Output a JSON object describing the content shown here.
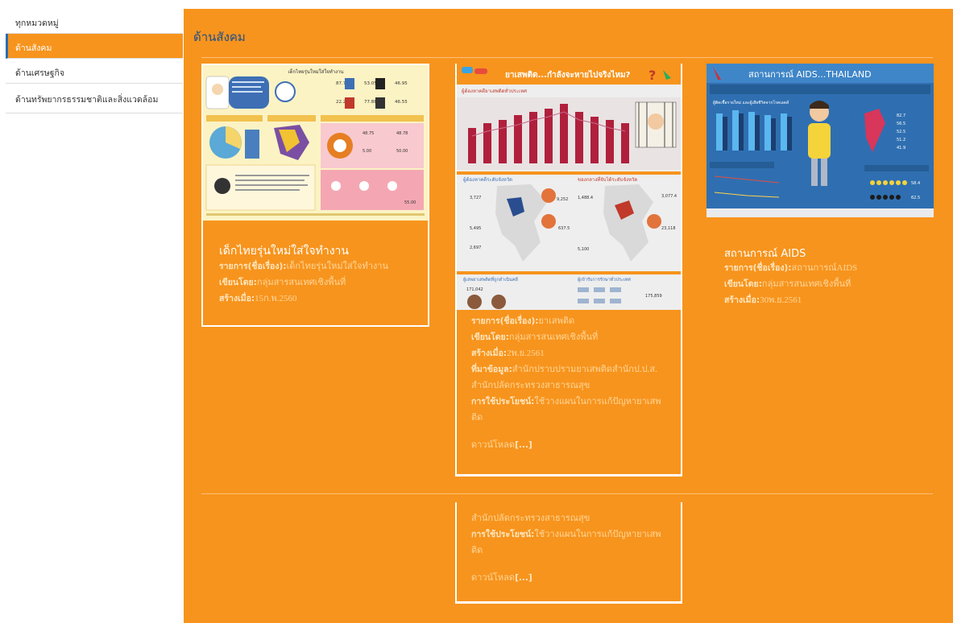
{
  "sidebar": {
    "items": [
      {
        "label": "ทุกหมวดหมู่"
      },
      {
        "label": "ด้านสังคม"
      },
      {
        "label": "ด้านเศรษฐกิจ"
      },
      {
        "label": "ด้านทรัพยากรธรรมชาติและสิ่งแวดล้อม"
      }
    ]
  },
  "main": {
    "section_title": "ด้านสังคม",
    "cards": [
      {
        "title": "เด็กไทยรุ่นใหม่ใส่ใจทำงาน",
        "topic_label": "รายการ(ชื่อเรื่อง):",
        "topic_value": "เด็กไทยรุ่นใหม่ใส่ใจทำงาน",
        "author_label": "เขียนโดย:",
        "author_value": "กลุ่มสารสนเทศเชิงพื้นที่",
        "created_label": "สร้างเมื่อ:",
        "created_value": "15ก.พ.2560",
        "infographic": {
          "heading": "เด็กไทยรุ่นใหม่ใส่ใจทำงาน",
          "stats": [
            "87.75",
            "53.05",
            "46.95",
            "22.25",
            "77.88",
            "46.55",
            "48.75",
            "48.78",
            "5.00",
            "50.00",
            "55.00"
          ]
        }
      },
      {
        "topic_label": "รายการ(ชื่อเรื่อง):",
        "topic_value": "ยาเสพติด",
        "author_label": "เขียนโดย:",
        "author_value": "กลุ่มสารสนเทศเชิงพื้นที่",
        "created_label": "สร้างเมื่อ:",
        "created_value": "2พ.ย.2561",
        "source_label": "ที่มาข้อมูล:",
        "source_value": "สำนักปราบปรามยาเสพติดสำนักป.ป.ส. สำนักปลัดกระทรวงสาธารณสุข",
        "usage_label": "การใช้ประโยชน์:",
        "usage_value": "ใช้วางแผนในการแก้ปัญหายาเสพติด",
        "download_label": "ดาวน์โหลด",
        "download_link": "[...]",
        "infographic": {
          "banner": "ยาเสพติด...กำลังจะหายไปจริงไหม?",
          "chart_title": "ผู้ต้องหาคดียาเสพติดทั่วประเทศ",
          "map_left_title": "ผู้ต้องหาคดีระดับจังหวัด",
          "map_right_title": "ของกลางที่จับได้ระดับจังหวัด",
          "bottom_left_title": "ผู้เสพยาเสพติดที่ถูกดำเนินคดี",
          "bottom_right_title": "ผู้เข้ารับการรักษาทั่วประเทศ",
          "figures": [
            "3,727",
            "9,252",
            "5,495",
            "2,697",
            "637.5",
            "3,077.4",
            "1,488.4",
            "23,118",
            "5,100",
            "171,042",
            "175,859"
          ]
        }
      },
      {
        "title": "สถานการณ์ AIDS",
        "topic_label": "รายการ(ชื่อเรื่อง):",
        "topic_value": "สถานการณ์AIDS",
        "author_label": "เขียนโดย:",
        "author_value": "กลุ่มสารสนเทศเชิงพื้นที่",
        "created_label": "สร้างเมื่อ:",
        "created_value": "30พ.ย.2561",
        "infographic": {
          "banner": "สถานการณ์ AIDS...THAILAND",
          "chart_title": "ผู้ติดเชื้อรายใหม่ และผู้เสียชีวิตจากโรคเอดส์",
          "legend": [
            "82.7",
            "56.5",
            "52.5",
            "51.2",
            "41.9"
          ],
          "figures": [
            "58.4",
            "62.5"
          ]
        }
      },
      {
        "source_value": "สำนักปลัดกระทรวงสาธารณสุข",
        "usage_label": "การใช้ประโยชน์:",
        "usage_value": "ใช้วางแผนในการแก้ปัญหายาเสพติด",
        "download_label": "ดาวน์โหลด",
        "download_link": "[...]"
      }
    ]
  },
  "colors": {
    "accent_orange": "#f7941d",
    "title_blue": "#1f4e8c",
    "meta_text": "#ffd699"
  }
}
